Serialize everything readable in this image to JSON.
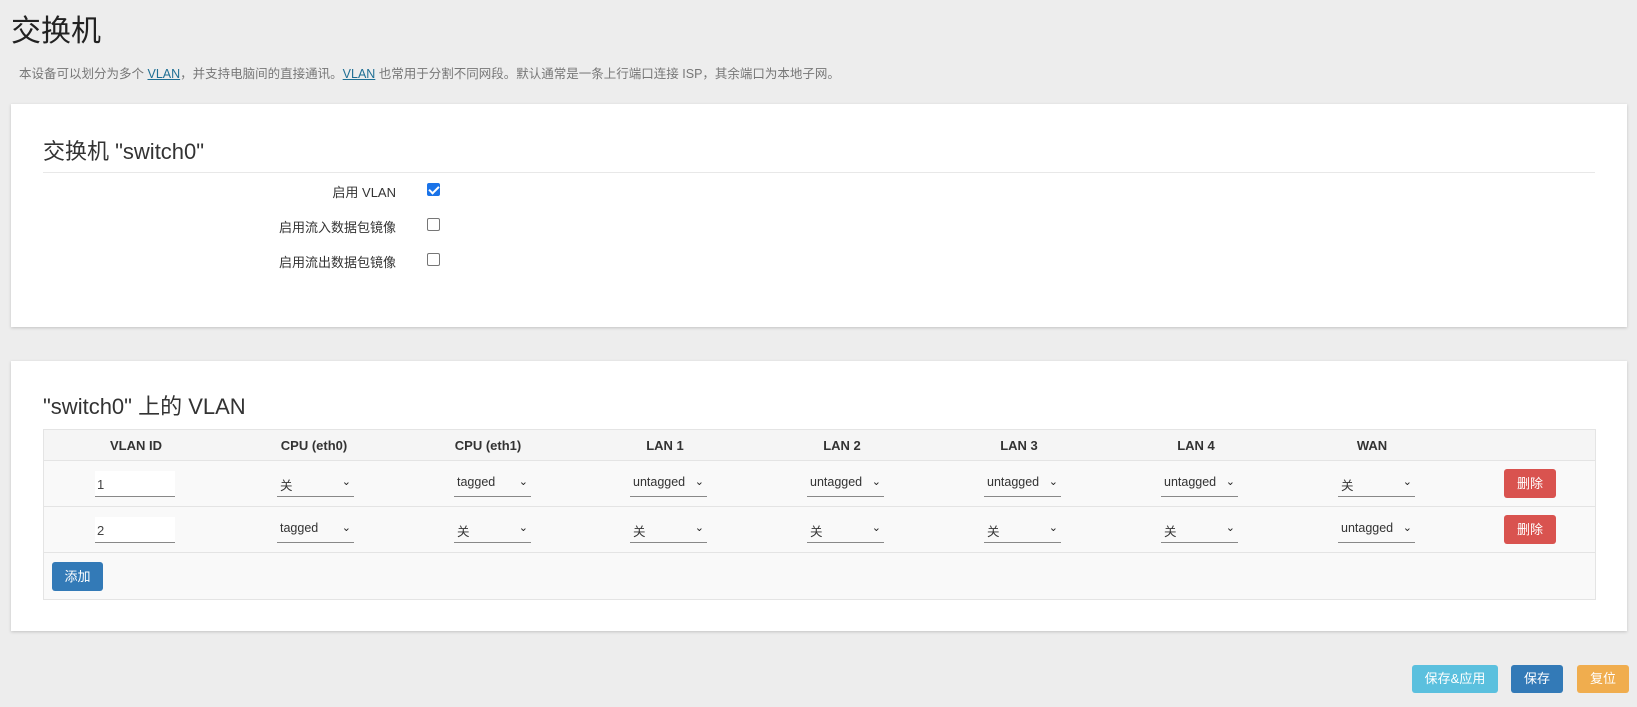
{
  "page": {
    "title": "交换机",
    "desc_part1": "本设备可以划分为多个 ",
    "desc_link1": "VLAN",
    "desc_part2": "，并支持电脑间的直接通讯。",
    "desc_link2": "VLAN",
    "desc_part3": " 也常用于分割不同网段。默认通常是一条上行端口连接 ISP，其余端口为本地子网。"
  },
  "switch_section": {
    "title": "交换机 \"switch0\"",
    "options": [
      {
        "label": "启用 VLAN",
        "checked": true
      },
      {
        "label": "启用流入数据包镜像",
        "checked": false
      },
      {
        "label": "启用流出数据包镜像",
        "checked": false
      }
    ]
  },
  "vlan_section": {
    "title": "\"switch0\" 上的 VLAN",
    "columns": [
      "VLAN ID",
      "CPU (eth0)",
      "CPU (eth1)",
      "LAN 1",
      "LAN 2",
      "LAN 3",
      "LAN 4",
      "WAN"
    ],
    "rows": [
      {
        "id": "1",
        "ports": [
          "关",
          "tagged",
          "untagged",
          "untagged",
          "untagged",
          "untagged",
          "关"
        ],
        "delete_label": "删除"
      },
      {
        "id": "2",
        "ports": [
          "tagged",
          "关",
          "关",
          "关",
          "关",
          "关",
          "untagged"
        ],
        "delete_label": "删除"
      }
    ],
    "add_label": "添加"
  },
  "footer": {
    "save_apply_label": "保存&应用",
    "save_label": "保存",
    "reset_label": "复位"
  },
  "colors": {
    "delete": "#d9534f",
    "primary": "#337ab7",
    "info": "#5bc0de",
    "warning": "#f0ad4e",
    "checkbox_on": "#1a73e8"
  }
}
